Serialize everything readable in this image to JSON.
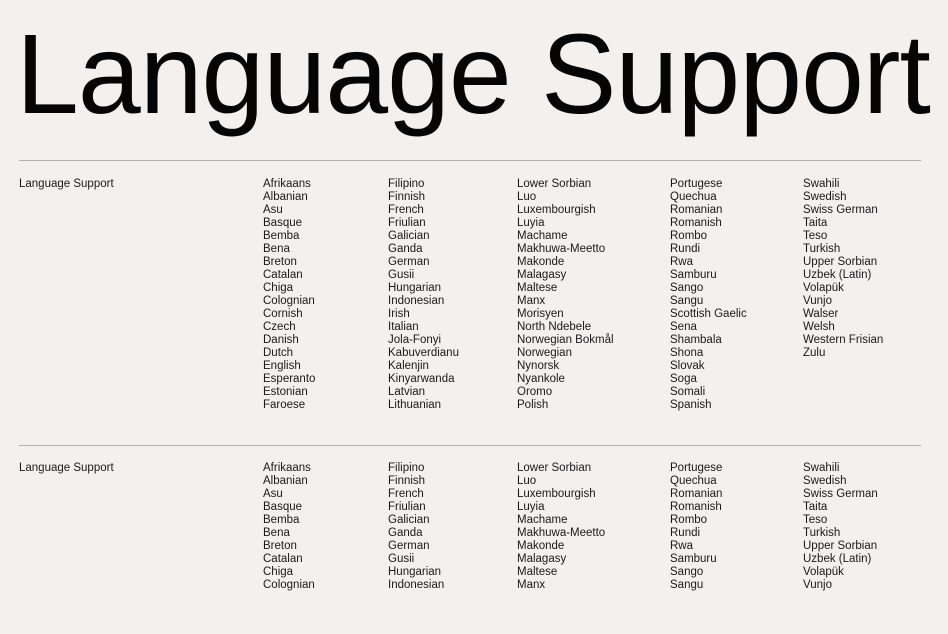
{
  "title": "Language Support",
  "sections": [
    {
      "label": "Language Support",
      "columns": [
        [
          "Afrikaans",
          "Albanian",
          "Asu",
          "Basque",
          "Bemba",
          "Bena",
          "Breton",
          "Catalan",
          "Chiga",
          "Colognian",
          "Cornish",
          "Czech",
          "Danish",
          "Dutch",
          "English",
          "Esperanto",
          "Estonian",
          "Faroese"
        ],
        [
          "Filipino",
          "Finnish",
          "French",
          "Friulian",
          "Galician",
          "Ganda",
          "German",
          "Gusii",
          "Hungarian",
          "Indonesian",
          "Irish",
          "Italian",
          "Jola-Fonyi",
          "Kabuverdianu",
          "Kalenjin",
          "Kinyarwanda",
          "Latvian",
          "Lithuanian"
        ],
        [
          "Lower Sorbian",
          "Luo",
          "Luxembourgish",
          "Luyia",
          "Machame",
          "Makhuwa-Meetto",
          "Makonde",
          "Malagasy",
          "Maltese",
          "Manx",
          "Morisyen",
          "North Ndebele",
          "Norwegian Bokmål",
          "Norwegian",
          "Nynorsk",
          "Nyankole",
          "Oromo",
          "Polish"
        ],
        [
          "Portugese",
          "Quechua",
          "Romanian",
          "Romanish",
          "Rombo",
          "Rundi",
          "Rwa",
          "Samburu",
          "Sango",
          "Sangu",
          "Scottish Gaelic",
          "Sena",
          "Shambala",
          "Shona",
          "Slovak",
          "Soga",
          "Somali",
          "Spanish"
        ],
        [
          "Swahili",
          "Swedish",
          "Swiss German",
          "Taita",
          "Teso",
          "Turkish",
          "Upper Sorbian",
          "Uzbek (Latin)",
          "Volapük",
          "Vunjo",
          "Walser",
          "Welsh",
          "Western Frisian",
          "Zulu"
        ]
      ]
    },
    {
      "label": "Language Support",
      "columns": [
        [
          "Afrikaans",
          "Albanian",
          "Asu",
          "Basque",
          "Bemba",
          "Bena",
          "Breton",
          "Catalan",
          "Chiga",
          "Colognian"
        ],
        [
          "Filipino",
          "Finnish",
          "French",
          "Friulian",
          "Galician",
          "Ganda",
          "German",
          "Gusii",
          "Hungarian",
          "Indonesian"
        ],
        [
          "Lower Sorbian",
          "Luo",
          "Luxembourgish",
          "Luyia",
          "Machame",
          "Makhuwa-Meetto",
          "Makonde",
          "Malagasy",
          "Maltese",
          "Manx"
        ],
        [
          "Portugese",
          "Quechua",
          "Romanian",
          "Romanish",
          "Rombo",
          "Rundi",
          "Rwa",
          "Samburu",
          "Sango",
          "Sangu"
        ],
        [
          "Swahili",
          "Swedish",
          "Swiss German",
          "Taita",
          "Teso",
          "Turkish",
          "Upper Sorbian",
          "Uzbek (Latin)",
          "Volapük",
          "Vunjo"
        ]
      ]
    }
  ]
}
